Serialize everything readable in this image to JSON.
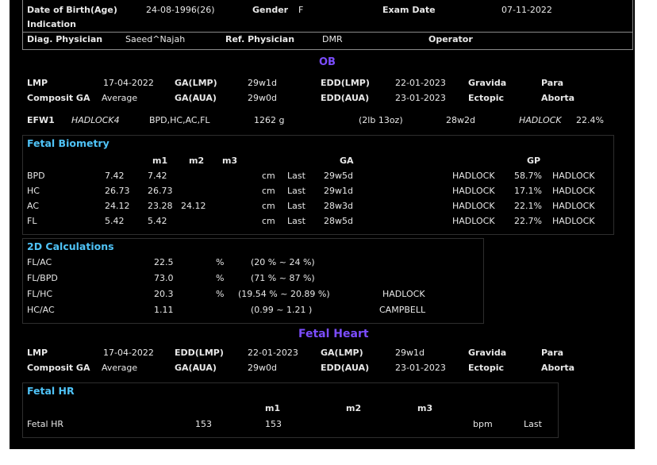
{
  "header": {
    "dob_label": "Date of Birth(Age)",
    "dob_value": "24-08-1996(26)",
    "gender_label": "Gender",
    "gender_value": "F",
    "exam_date_label": "Exam Date",
    "exam_date_value": "07-11-2022",
    "indication_label": "Indication",
    "diag_physician_label": "Diag. Physician",
    "diag_physician_value": "Saeed^Najah",
    "ref_physician_label": "Ref. Physician",
    "ref_physician_value": "DMR",
    "operator_label": "Operator"
  },
  "ob": {
    "title": "OB",
    "lmp_label": "LMP",
    "lmp_value": "17-04-2022",
    "ga_lmp_label": "GA(LMP)",
    "ga_lmp_value": "29w1d",
    "edd_lmp_label": "EDD(LMP)",
    "edd_lmp_value": "22-01-2023",
    "gravida_label": "Gravida",
    "para_label": "Para",
    "composit_label": "Composit GA",
    "composit_value": "Average",
    "ga_aua_label": "GA(AUA)",
    "ga_aua_value": "29w0d",
    "edd_aua_label": "EDD(AUA)",
    "edd_aua_value": "23-01-2023",
    "ectopic_label": "Ectopic",
    "aborta_label": "Aborta",
    "efw_label": "EFW1",
    "efw_method": "HADLOCK4",
    "efw_params": "BPD,HC,AC,FL",
    "efw_weight": "1262 g",
    "efw_lb": "(2lb 13oz)",
    "efw_ga": "28w2d",
    "efw_ref": "HADLOCK",
    "efw_pct": "22.4%"
  },
  "biometry": {
    "title": "Fetal Biometry",
    "headers": {
      "m1": "m1",
      "m2": "m2",
      "m3": "m3",
      "ga": "GA",
      "gp": "GP"
    },
    "rows": [
      {
        "name": "BPD",
        "val": "7.42",
        "m1": "7.42",
        "m2": "",
        "m3": "",
        "unit": "cm",
        "mode": "Last",
        "ga": "29w5d",
        "ref": "HADLOCK",
        "gp": "58.7%",
        "ref2": "HADLOCK"
      },
      {
        "name": "HC",
        "val": "26.73",
        "m1": "26.73",
        "m2": "",
        "m3": "",
        "unit": "cm",
        "mode": "Last",
        "ga": "29w1d",
        "ref": "HADLOCK",
        "gp": "17.1%",
        "ref2": "HADLOCK"
      },
      {
        "name": "AC",
        "val": "24.12",
        "m1": "23.28",
        "m2": "24.12",
        "m3": "",
        "unit": "cm",
        "mode": "Last",
        "ga": "28w3d",
        "ref": "HADLOCK",
        "gp": "22.1%",
        "ref2": "HADLOCK"
      },
      {
        "name": "FL",
        "val": "5.42",
        "m1": "5.42",
        "m2": "",
        "m3": "",
        "unit": "cm",
        "mode": "Last",
        "ga": "28w5d",
        "ref": "HADLOCK",
        "gp": "22.7%",
        "ref2": "HADLOCK"
      }
    ]
  },
  "calc": {
    "title": "2D Calculations",
    "rows": [
      {
        "name": "FL/AC",
        "val": "22.5",
        "unit": "%",
        "range": "(20 % ~ 24 %)",
        "ref": ""
      },
      {
        "name": "FL/BPD",
        "val": "73.0",
        "unit": "%",
        "range": "(71 % ~ 87 %)",
        "ref": ""
      },
      {
        "name": "FL/HC",
        "val": "20.3",
        "unit": "%",
        "range": "(19.54 % ~ 20.89 %)",
        "ref": "HADLOCK"
      },
      {
        "name": "HC/AC",
        "val": "1.11",
        "unit": "",
        "range": "(0.99 ~ 1.21 )",
        "ref": "CAMPBELL"
      }
    ]
  },
  "heart": {
    "title": "Fetal Heart",
    "lmp_label": "LMP",
    "lmp_value": "17-04-2022",
    "edd_lmp_label": "EDD(LMP)",
    "edd_lmp_value": "22-01-2023",
    "ga_lmp_label": "GA(LMP)",
    "ga_lmp_value": "29w1d",
    "gravida_label": "Gravida",
    "para_label": "Para",
    "composit_label": "Composit GA",
    "composit_value": "Average",
    "ga_aua_label": "GA(AUA)",
    "ga_aua_value": "29w0d",
    "edd_aua_label": "EDD(AUA)",
    "edd_aua_value": "23-01-2023",
    "ectopic_label": "Ectopic",
    "aborta_label": "Aborta"
  },
  "hr": {
    "title": "Fetal HR",
    "m1": "m1",
    "m2": "m2",
    "m3": "m3",
    "row_label": "Fetal HR",
    "value": "153",
    "m1_value": "153",
    "unit": "bpm",
    "mode": "Last"
  },
  "colors": {
    "background": "#000000",
    "text": "#e8e8e8",
    "section": "#4fc3f7",
    "title": "#7c4dff"
  }
}
